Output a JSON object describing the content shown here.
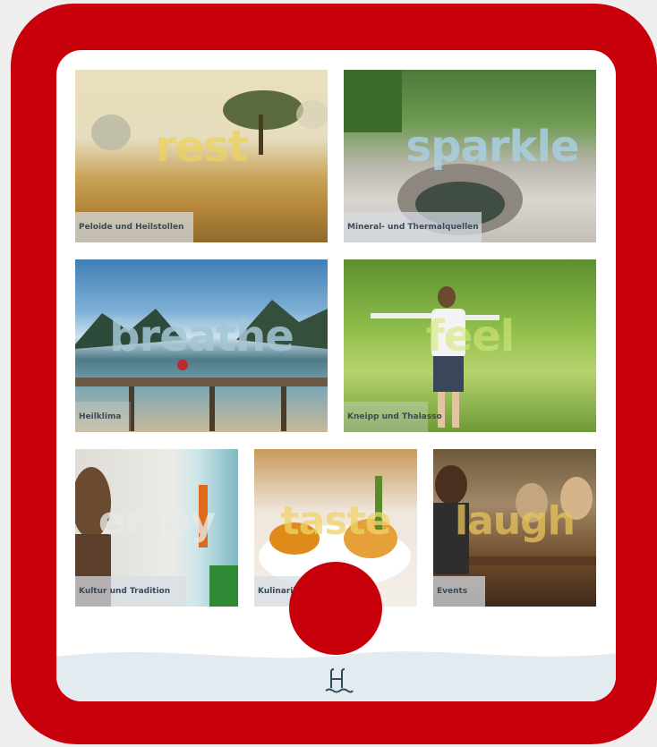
{
  "tiles": [
    {
      "word": "rest",
      "caption": "Peloide und Heilstollen",
      "word_color": "#ecd35e"
    },
    {
      "word": "sparkle",
      "caption": "Mineral- und Thermalquellen",
      "word_color": "#a9cfe0"
    },
    {
      "word": "breathe",
      "caption": "Heilklima",
      "word_color": "#a4c6d6"
    },
    {
      "word": "feel",
      "caption": "Kneipp und Thalasso",
      "word_color": "#d6e878"
    },
    {
      "word": "enjoy",
      "caption": "Kultur und Tradition",
      "word_color": "#e8e8e8"
    },
    {
      "word": "taste",
      "caption": "Kulinarik",
      "word_color": "#f0d46a"
    },
    {
      "word": "laugh",
      "caption": "Events",
      "word_color": "#e8c45a"
    }
  ],
  "logo_icon": "spa-pool-icon",
  "home_icon": "home-button",
  "colors": {
    "frame": "#c8000b",
    "screen": "#ffffff",
    "wave": "#e4ebf0"
  }
}
